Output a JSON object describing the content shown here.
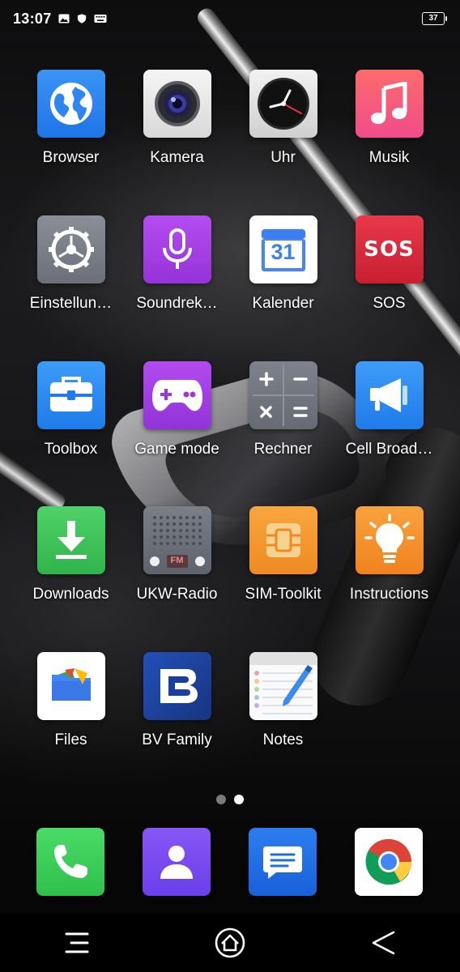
{
  "status_bar": {
    "time": "13:07",
    "icons": [
      "image-icon",
      "shield-icon",
      "keyboard-icon"
    ],
    "battery_level": "37"
  },
  "apps": [
    {
      "label": "Browser",
      "icon": "globe-icon"
    },
    {
      "label": "Kamera",
      "icon": "camera-icon"
    },
    {
      "label": "Uhr",
      "icon": "clock-icon"
    },
    {
      "label": "Musik",
      "icon": "music-note-icon"
    },
    {
      "label": "Einstellun…",
      "icon": "gear-icon"
    },
    {
      "label": "Soundrek…",
      "icon": "microphone-icon"
    },
    {
      "label": "Kalender",
      "icon": "calendar-icon",
      "icon_text": "31"
    },
    {
      "label": "SOS",
      "icon": "sos-icon",
      "icon_text": "SOS"
    },
    {
      "label": "Toolbox",
      "icon": "toolbox-icon"
    },
    {
      "label": "Game mode",
      "icon": "gamepad-icon"
    },
    {
      "label": "Rechner",
      "icon": "calculator-icon"
    },
    {
      "label": "Cell Broad…",
      "icon": "megaphone-icon"
    },
    {
      "label": "Downloads",
      "icon": "download-icon"
    },
    {
      "label": "UKW-Radio",
      "icon": "radio-icon",
      "icon_text": "FM"
    },
    {
      "label": "SIM-Toolkit",
      "icon": "sim-card-icon"
    },
    {
      "label": "Instructions",
      "icon": "lightbulb-icon"
    },
    {
      "label": "Files",
      "icon": "files-icon"
    },
    {
      "label": "BV Family",
      "icon": "bv-family-icon"
    },
    {
      "label": "Notes",
      "icon": "notes-icon"
    }
  ],
  "page_indicator": {
    "pages": 2,
    "active": 2
  },
  "dock": [
    {
      "icon": "phone-icon"
    },
    {
      "icon": "contacts-icon"
    },
    {
      "icon": "messages-icon"
    },
    {
      "icon": "chrome-icon"
    }
  ],
  "nav_bar": [
    "menu-icon",
    "home-icon",
    "back-icon"
  ],
  "colors": {
    "browser": "#2f86f0",
    "music": "#f6557a",
    "soundrecorder": "#a040e0",
    "sos": "#d8283a",
    "toolbox": "#2f8ef5",
    "game": "#a63fe0",
    "downloads": "#3fc45a",
    "sim": "#f59b2f",
    "instructions": "#f7912c",
    "bvfamily": "#1b3f9e",
    "phone": "#3ccf5a",
    "contacts": "#7a4ef2",
    "messages": "#1e6fe0"
  }
}
